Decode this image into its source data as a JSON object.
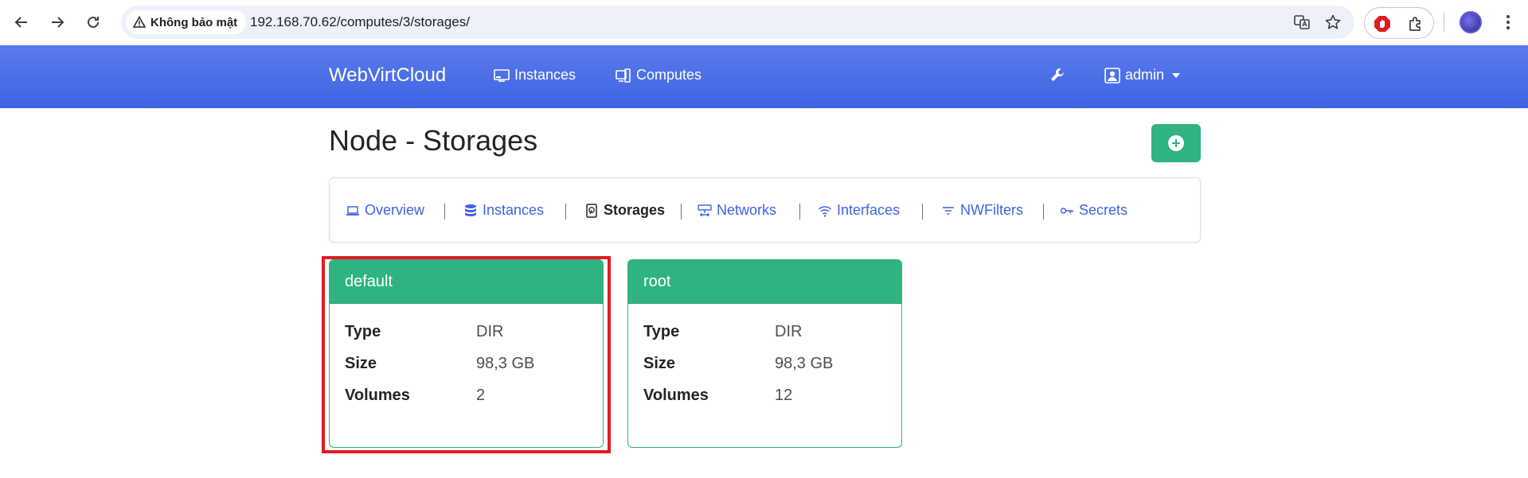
{
  "browser": {
    "security_label": "Không bảo mật",
    "url": "192.168.70.62/computes/3/storages/",
    "icons": [
      "back-icon",
      "forward-icon",
      "reload-icon",
      "translate-icon",
      "star-icon",
      "adblock-icon",
      "extensions-icon",
      "profile-icon",
      "menu-icon"
    ]
  },
  "navbar": {
    "brand": "WebVirtCloud",
    "links": [
      {
        "label": "Instances",
        "icon": "monitor-icon"
      },
      {
        "label": "Computes",
        "icon": "server-icon"
      }
    ],
    "settings_icon": "wrench-icon",
    "user": {
      "label": "admin",
      "icon": "user-icon"
    }
  },
  "page": {
    "title": "Node - Storages",
    "add_button_icon": "plus-circle-icon"
  },
  "tabs": [
    {
      "label": "Overview",
      "icon": "laptop-icon",
      "active": false
    },
    {
      "label": "Instances",
      "icon": "database-icon",
      "active": false
    },
    {
      "label": "Storages",
      "icon": "hdd-icon",
      "active": true
    },
    {
      "label": "Networks",
      "icon": "network-icon",
      "active": false
    },
    {
      "label": "Interfaces",
      "icon": "wifi-icon",
      "active": false
    },
    {
      "label": "NWFilters",
      "icon": "filter-icon",
      "active": false
    },
    {
      "label": "Secrets",
      "icon": "key-icon",
      "active": false
    }
  ],
  "pools": [
    {
      "name": "default",
      "rows": [
        {
          "key": "Type",
          "value": "DIR"
        },
        {
          "key": "Size",
          "value": "98,3 GB"
        },
        {
          "key": "Volumes",
          "value": "2"
        }
      ]
    },
    {
      "name": "root",
      "rows": [
        {
          "key": "Type",
          "value": "DIR"
        },
        {
          "key": "Size",
          "value": "98,3 GB"
        },
        {
          "key": "Volumes",
          "value": "12"
        }
      ]
    }
  ],
  "colors": {
    "navbar": "#3f63e6",
    "link": "#3f63e6",
    "success": "#2fb380",
    "highlight": "#e01b24"
  }
}
